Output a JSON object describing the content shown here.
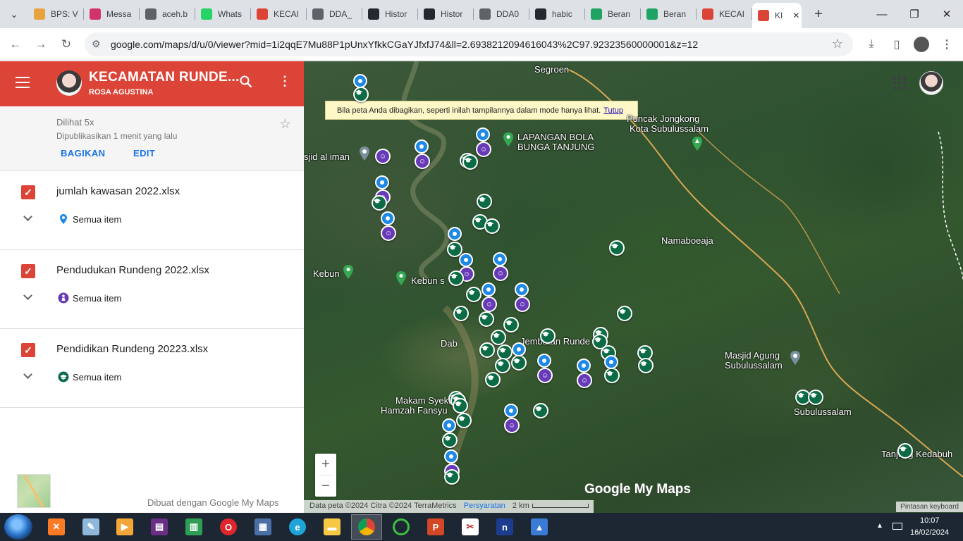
{
  "browser": {
    "tabs": [
      {
        "label": "BPS: V",
        "icon": "bps-icon",
        "color": "#e8a33d"
      },
      {
        "label": "Messa",
        "icon": "messenger-icon",
        "color": "#d23369"
      },
      {
        "label": "aceh.b",
        "icon": "globe-icon",
        "color": "#5f6368"
      },
      {
        "label": "Whats",
        "icon": "whatsapp-icon",
        "color": "#25d366"
      },
      {
        "label": "KECAI",
        "icon": "mymaps-icon",
        "color": "#db4437"
      },
      {
        "label": "DDA_",
        "icon": "globe-icon",
        "color": "#5f6368"
      },
      {
        "label": "Histor",
        "icon": "github-icon",
        "color": "#24292f"
      },
      {
        "label": "Histor",
        "icon": "github-icon",
        "color": "#24292f"
      },
      {
        "label": "DDA0",
        "icon": "globe-icon",
        "color": "#5f6368"
      },
      {
        "label": "habic",
        "icon": "github-icon",
        "color": "#24292f"
      },
      {
        "label": "Beran",
        "icon": "drive-icon",
        "color": "#1fa463"
      },
      {
        "label": "Beran",
        "icon": "drive-icon",
        "color": "#1fa463"
      },
      {
        "label": "KECAI",
        "icon": "mymaps-icon",
        "color": "#db4437"
      },
      {
        "label": "KI",
        "icon": "mymaps-icon",
        "color": "#db4437",
        "active": true
      }
    ],
    "url": "google.com/maps/d/u/0/viewer?mid=1i2qqE7Mu88P1pUnxYfkkCGaYJfxfJ74&ll=2.6938212094616043%2C97.92323560000001&z=12"
  },
  "panel": {
    "title": "KECAMATAN RUNDE...",
    "author": "ROSA AGUSTINA",
    "views": "Dilihat 5x",
    "published": "Dipublikasikan 1 menit yang lalu",
    "share_label": "BAGIKAN",
    "edit_label": "EDIT",
    "layers": [
      {
        "name": "jumlah kawasan 2022.xlsx",
        "item_label": "Semua item",
        "icon": "blue-pin-icon"
      },
      {
        "name": "Pendudukan Rundeng 2022.xlsx",
        "item_label": "Semua item",
        "icon": "purple-person-icon"
      },
      {
        "name": "Pendidikan Rundeng 20223.xlsx",
        "item_label": "Semua item",
        "icon": "green-school-icon"
      }
    ],
    "made_with": "Dibuat dengan Google My Maps"
  },
  "map": {
    "banner_text": "Bila peta Anda dibagikan, seperti inilah tampilannya dalam mode hanya lihat.",
    "banner_close": "Tutup",
    "labels": {
      "segroen": "Segroen",
      "puncak": "Puncak Jongkong",
      "kota": "Kota Subulussalam",
      "lapangan1": "LAPANGAN BOLA",
      "lapangan2": "BUNGA TANJUNG",
      "masjid_iman": "sjid al iman",
      "namaboeaja": "Namaboeaja",
      "kebun": "Kebun",
      "kebun_s": "Kebun s",
      "dab": "Dab",
      "jembatan": "Jembatan Runde",
      "masjid_agung1": "Masjid Agung",
      "masjid_agung2": "Subulussalam",
      "subulussalam": "Subulussalam",
      "makam1": "Makam Syekh",
      "makam2": "Hamzah Fansyu",
      "tanjung": "Tanjung Kedabuh"
    },
    "logo": "Google My Maps",
    "attribution": "Data peta ©2024 Citra ©2024 TerraMetrics",
    "terms": "Persyaratan",
    "scale": "2 km",
    "shortcuts": "Pintasan keyboard",
    "zoom_in": "+",
    "zoom_out": "−"
  },
  "taskbar": {
    "time": "10:07",
    "date": "16/02/2024"
  }
}
